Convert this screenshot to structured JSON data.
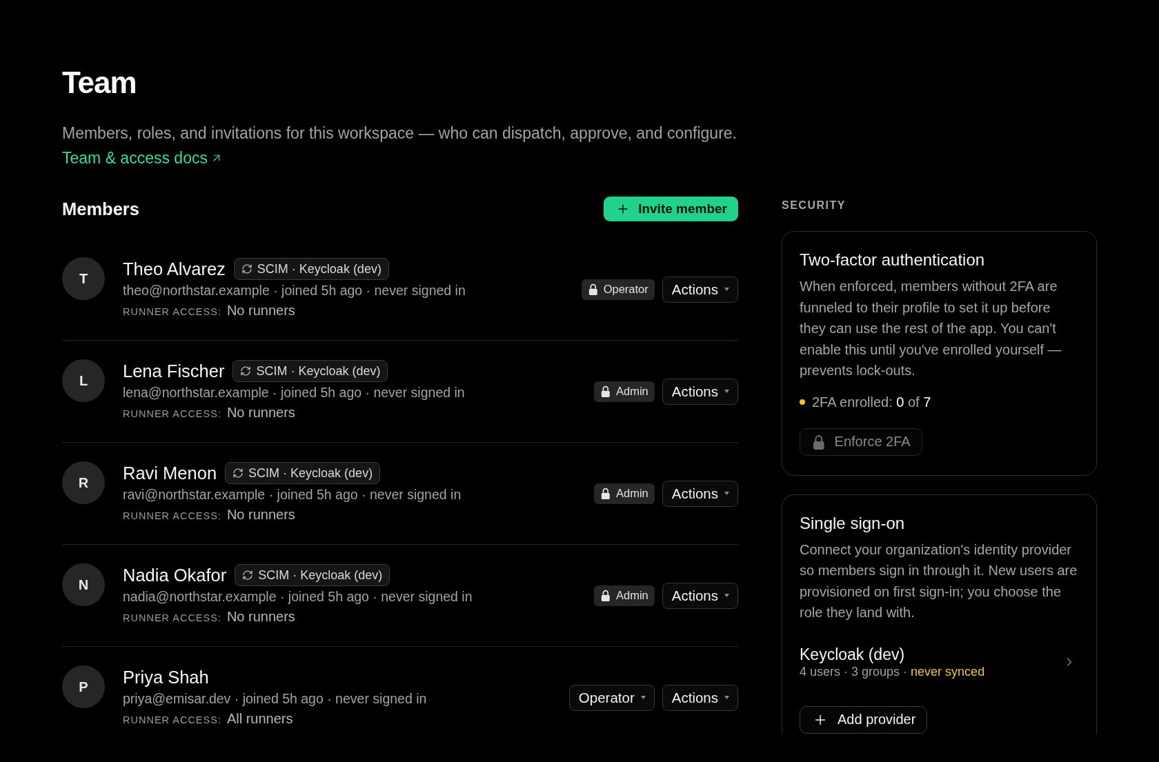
{
  "header": {
    "title": "Team",
    "description": "Members, roles, and invitations for this workspace — who can dispatch, approve, and configure.",
    "docs_link": "Team & access docs"
  },
  "members": {
    "title": "Members",
    "invite_button": "Invite member",
    "rows": [
      {
        "initial": "T",
        "name": "Theo Alvarez",
        "source": "SCIM · Keycloak (dev)",
        "details": "theo@northstar.example · joined 5h ago · never signed in",
        "runner_access_label": "RUNNER ACCESS:",
        "runner_access": "No runners",
        "role": {
          "kind": "locked",
          "label": "Operator"
        },
        "actions": "Actions"
      },
      {
        "initial": "L",
        "name": "Lena Fischer",
        "source": "SCIM · Keycloak (dev)",
        "details": "lena@northstar.example · joined 5h ago · never signed in",
        "runner_access_label": "RUNNER ACCESS:",
        "runner_access": "No runners",
        "role": {
          "kind": "locked",
          "label": "Admin"
        },
        "actions": "Actions"
      },
      {
        "initial": "R",
        "name": "Ravi Menon",
        "source": "SCIM · Keycloak (dev)",
        "details": "ravi@northstar.example · joined 5h ago · never signed in",
        "runner_access_label": "RUNNER ACCESS:",
        "runner_access": "No runners",
        "role": {
          "kind": "locked",
          "label": "Admin"
        },
        "actions": "Actions"
      },
      {
        "initial": "N",
        "name": "Nadia Okafor",
        "source": "SCIM · Keycloak (dev)",
        "details": "nadia@northstar.example · joined 5h ago · never signed in",
        "runner_access_label": "RUNNER ACCESS:",
        "runner_access": "No runners",
        "role": {
          "kind": "locked",
          "label": "Admin"
        },
        "actions": "Actions"
      },
      {
        "initial": "P",
        "name": "Priya Shah",
        "details": "priya@emisar.dev · joined 5h ago · never signed in",
        "runner_access_label": "RUNNER ACCESS:",
        "runner_access": "All runners",
        "role": {
          "kind": "select",
          "label": "Operator"
        },
        "actions": "Actions"
      }
    ]
  },
  "security": {
    "title": "SECURITY",
    "two_factor": {
      "title": "Two-factor authentication",
      "description": "When enforced, members without 2FA are funneled to their profile to set it up before they can use the rest of the app. You can't enable this until you've enrolled yourself — prevents lock-outs.",
      "status": {
        "color": "#fbbf24",
        "text": "2FA enrolled: **0** of **7**"
      },
      "enforce_button": {
        "label": "Enforce 2FA",
        "disabled": true
      }
    },
    "sso": {
      "title": "Single sign-on",
      "description": "Connect your organization's identity provider so members sign in through it. New users are provisioned on first sign-in; you choose the role they land with.",
      "providers": [
        {
          "name": "Keycloak (dev)",
          "stats": "4 users · 3 groups ·",
          "sync_status": "never synced",
          "synced": false
        }
      ],
      "add_button": "Add provider"
    }
  }
}
